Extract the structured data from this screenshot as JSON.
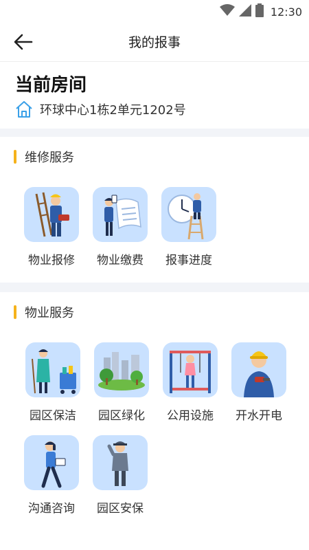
{
  "status_bar": {
    "time": "12:30"
  },
  "header": {
    "title": "我的报事"
  },
  "current_room": {
    "label": "当前房间",
    "address": "环球中心1栋2单元1202号"
  },
  "repair_section": {
    "title": "维修服务",
    "items": [
      {
        "label": "物业报修",
        "icon": "repair-worker-icon"
      },
      {
        "label": "物业缴费",
        "icon": "bill-payment-icon"
      },
      {
        "label": "报事进度",
        "icon": "progress-clock-icon"
      }
    ]
  },
  "property_section": {
    "title": "物业服务",
    "items": [
      {
        "label": "园区保洁",
        "icon": "cleaning-icon"
      },
      {
        "label": "园区绿化",
        "icon": "greening-icon"
      },
      {
        "label": "公用设施",
        "icon": "public-facility-icon"
      },
      {
        "label": "开水开电",
        "icon": "water-electric-icon"
      },
      {
        "label": "沟通咨询",
        "icon": "consultation-icon"
      },
      {
        "label": "园区安保",
        "icon": "security-guard-icon"
      }
    ]
  },
  "colors": {
    "accent_bar": "#f5b21b",
    "icon_bg": "#c9e1ff",
    "home_icon": "#3aa0e8"
  }
}
